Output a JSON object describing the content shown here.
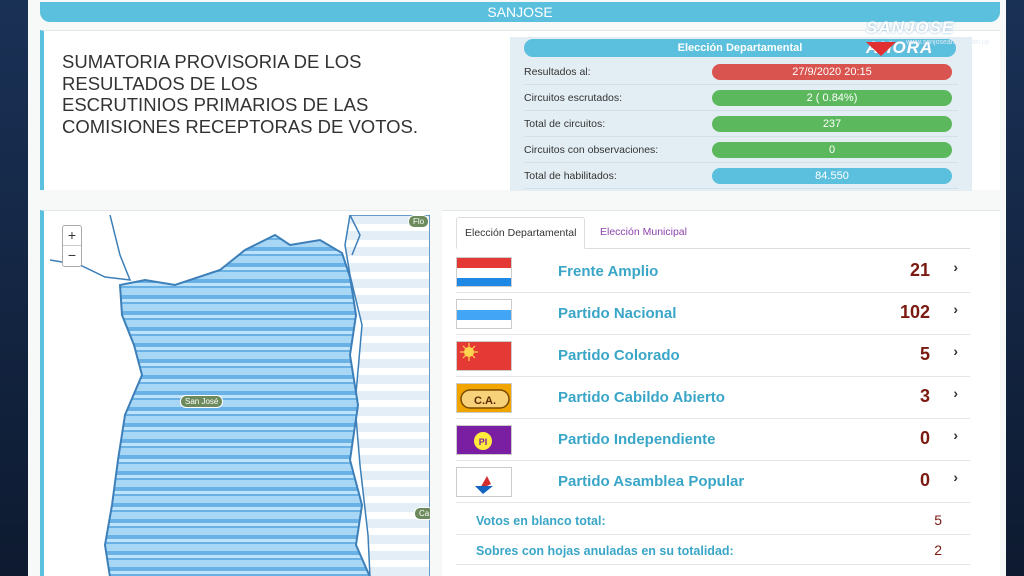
{
  "header": {
    "title": "SANJOSE"
  },
  "logo": {
    "main": "SANJOSE AHORA",
    "sub": "www.sanjoseahora.com.uy"
  },
  "summary": {
    "title_lines": [
      "SUMATORIA PROVISORIA DE LOS",
      "RESULTADOS DE LOS",
      "ESCRUTINIOS PRIMARIOS DE LAS",
      "COMISIONES RECEPTORAS DE VOTOS."
    ]
  },
  "stats": {
    "header": "Elección Departamental",
    "rows": [
      {
        "label": "Resultados al:",
        "value": "27/9/2020 20:15",
        "color": "#d9534f"
      },
      {
        "label": "Circuitos escrutados:",
        "value": "2 ( 0.84%)",
        "color": "#5cb85c"
      },
      {
        "label": "Total de circuitos:",
        "value": "237",
        "color": "#5cb85c"
      },
      {
        "label": "Circuitos con observaciones:",
        "value": "0",
        "color": "#5cb85c"
      },
      {
        "label": "Total de habilitados:",
        "value": "84.550",
        "color": "#5bc0de"
      }
    ]
  },
  "map": {
    "zoom_in": "+",
    "zoom_out": "−",
    "labels": {
      "center": "San José",
      "top_right": "Flo",
      "right": "Ca"
    }
  },
  "tabs": [
    {
      "label": "Elección Departamental",
      "active": true
    },
    {
      "label": "Elección Municipal",
      "active": false
    }
  ],
  "parties": [
    {
      "name": "Frente Amplio",
      "votes": "21",
      "flag": "fa-flag"
    },
    {
      "name": "Partido Nacional",
      "votes": "102",
      "flag": "pn-flag"
    },
    {
      "name": "Partido Colorado",
      "votes": "5",
      "flag": "pc-flag"
    },
    {
      "name": "Partido Cabildo Abierto",
      "votes": "3",
      "flag": "ca-flag",
      "flag_text": "C.A."
    },
    {
      "name": "Partido Independiente",
      "votes": "0",
      "flag": "pi-flag",
      "flag_text": "PI"
    },
    {
      "name": "Partido Asamblea Popular",
      "votes": "0",
      "flag": "ap-flag"
    }
  ],
  "extras": [
    {
      "label": "Votos en blanco total:",
      "value": "5"
    },
    {
      "label": "Sobres con hojas anuladas en su totalidad:",
      "value": "2"
    }
  ],
  "colors": {
    "accent": "#5bc0de",
    "red": "#d9534f",
    "green": "#5cb85c",
    "party_name": "#3aa6c7",
    "vote_number": "#7a1a10",
    "map_fill": "#8cc4ec",
    "map_stroke": "#3d7fb8"
  }
}
